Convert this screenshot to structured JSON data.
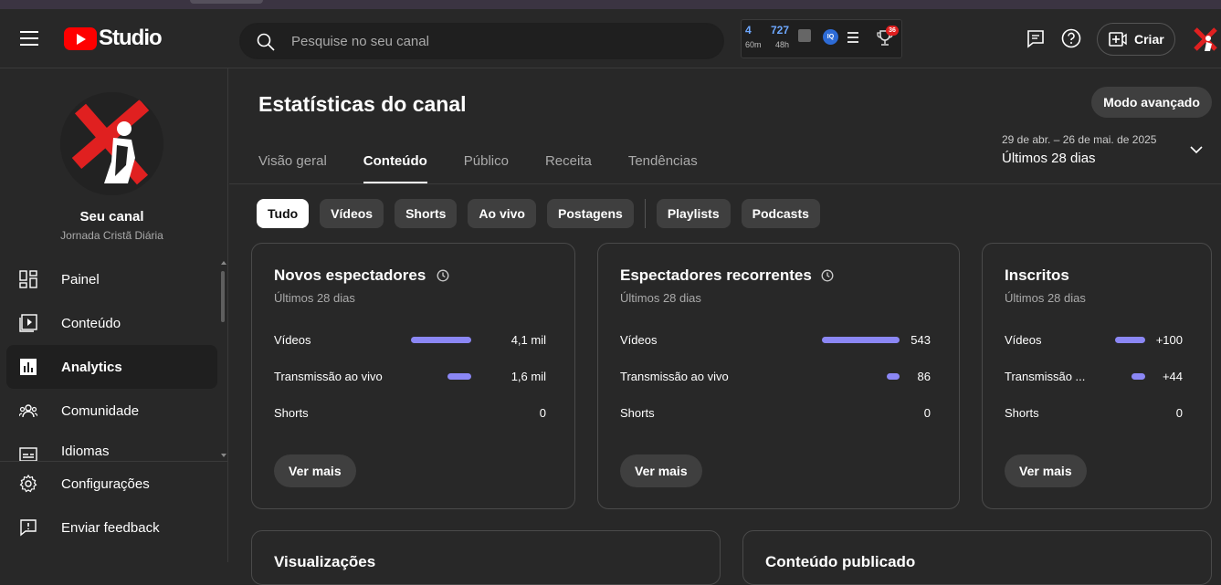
{
  "app": {
    "logo_text": "Studio"
  },
  "search": {
    "placeholder": "Pesquise no seu canal"
  },
  "extension": {
    "stat1": {
      "value": "4",
      "sub": "60m"
    },
    "stat2": {
      "value": "727",
      "sub": "48h"
    },
    "iq_label": "IQ",
    "notif_count": "36"
  },
  "header": {
    "create_label": "Criar"
  },
  "channel": {
    "name": "Seu canal",
    "subtitle": "Jornada Cristã Diária"
  },
  "sidebar": {
    "items": [
      {
        "label": "Painel",
        "icon": "dashboard-icon"
      },
      {
        "label": "Conteúdo",
        "icon": "content-icon"
      },
      {
        "label": "Analytics",
        "icon": "analytics-icon",
        "active": true
      },
      {
        "label": "Comunidade",
        "icon": "community-icon"
      },
      {
        "label": "Idiomas",
        "icon": "subtitles-icon"
      }
    ],
    "bottom_items": [
      {
        "label": "Configurações",
        "icon": "gear-icon"
      },
      {
        "label": "Enviar feedback",
        "icon": "feedback-icon"
      }
    ]
  },
  "main": {
    "title": "Estatísticas do canal",
    "advanced_label": "Modo avançado",
    "tabs": [
      "Visão geral",
      "Conteúdo",
      "Público",
      "Receita",
      "Tendências"
    ],
    "active_tab": 1,
    "date_range": {
      "dates": "29 de abr. – 26 de mai. de 2025",
      "label": "Últimos 28 dias"
    },
    "chips": [
      "Tudo",
      "Vídeos",
      "Shorts",
      "Ao vivo",
      "Postagens",
      "Playlists",
      "Podcasts"
    ],
    "active_chip": 0
  },
  "cards": [
    {
      "title": "Novos espectadores",
      "subtitle": "Últimos 28 dias",
      "more_label": "Ver mais",
      "rows": [
        {
          "label": "Vídeos",
          "value": "4,1 mil",
          "fill": 1.0
        },
        {
          "label": "Transmissão ao vivo",
          "value": "1,6 mil",
          "fill": 0.39
        },
        {
          "label": "Shorts",
          "value": "0",
          "fill": 0
        }
      ]
    },
    {
      "title": "Espectadores recorrentes",
      "subtitle": "Últimos 28 dias",
      "more_label": "Ver mais",
      "rows": [
        {
          "label": "Vídeos",
          "value": "543",
          "fill": 1.0
        },
        {
          "label": "Transmissão ao vivo",
          "value": "86",
          "fill": 0.16
        },
        {
          "label": "Shorts",
          "value": "0",
          "fill": 0
        }
      ]
    },
    {
      "title": "Inscritos",
      "subtitle": "Últimos 28 dias",
      "more_label": "Ver mais",
      "rows": [
        {
          "label": "Vídeos",
          "value": "+100",
          "fill": 1.0
        },
        {
          "label": "Transmissão ...",
          "value": "+44",
          "fill": 0.44
        },
        {
          "label": "Shorts",
          "value": "0",
          "fill": 0
        }
      ]
    }
  ],
  "bottom_cards": [
    "Visualizações",
    "Conteúdo publicado"
  ],
  "colors": {
    "accent_bar": "#8b87f5",
    "brand_red": "#ff0000",
    "background": "#282828"
  }
}
